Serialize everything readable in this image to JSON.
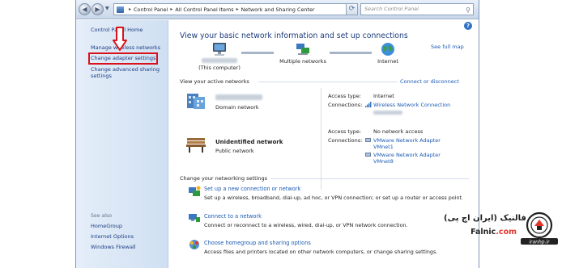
{
  "address_bar": {
    "crumbs": [
      "Control Panel",
      "All Control Panel Items",
      "Network and Sharing Center"
    ],
    "search_placeholder": "Search Control Panel"
  },
  "sidebar": {
    "home": "Control Panel Home",
    "manage_wireless": "Manage wireless networks",
    "change_adapter": "Change adapter settings",
    "change_advanced": "Change advanced sharing settings",
    "see_also_label": "See also",
    "see_also": [
      "HomeGroup",
      "Internet Options",
      "Windows Firewall"
    ]
  },
  "main": {
    "title": "View your basic network information and set up connections",
    "see_full_map": "See full map",
    "map": {
      "this_computer": "(This computer)",
      "middle": "Multiple networks",
      "internet": "Internet"
    },
    "active_networks_label": "View your active networks",
    "connect_or_disconnect": "Connect or disconnect",
    "networks": [
      {
        "type_label": "Domain network",
        "access_key": "Access type:",
        "access_val": "Internet",
        "connections_key": "Connections:",
        "connections": [
          "Wireless Network Connection"
        ]
      },
      {
        "name": "Unidentified network",
        "type_label": "Public network",
        "access_key": "Access type:",
        "access_val": "No network access",
        "connections_key": "Connections:",
        "connections": [
          "VMware Network Adapter",
          "VMnet1",
          "VMware Network Adapter",
          "VMnet8"
        ]
      }
    ],
    "change_settings_label": "Change your networking settings",
    "tasks": [
      {
        "link": "Set up a new connection or network",
        "desc": "Set up a wireless, broadband, dial-up, ad hoc, or VPN connection; or set up a router or access point."
      },
      {
        "link": "Connect to a network",
        "desc": "Connect or reconnect to a wireless, wired, dial-up, or VPN network connection."
      },
      {
        "link": "Choose homegroup and sharing options",
        "desc": "Access files and printers located on other network computers, or change sharing settings."
      }
    ]
  },
  "watermark": {
    "persian": "فالنیک (ایران اچ پی)",
    "brand_main": "Falnic",
    "brand_suffix": ".com",
    "logo_text": "iranhp.ir"
  },
  "colors": {
    "link": "#1b5ab5",
    "title": "#1e3c7e",
    "highlight": "#d8121b"
  }
}
